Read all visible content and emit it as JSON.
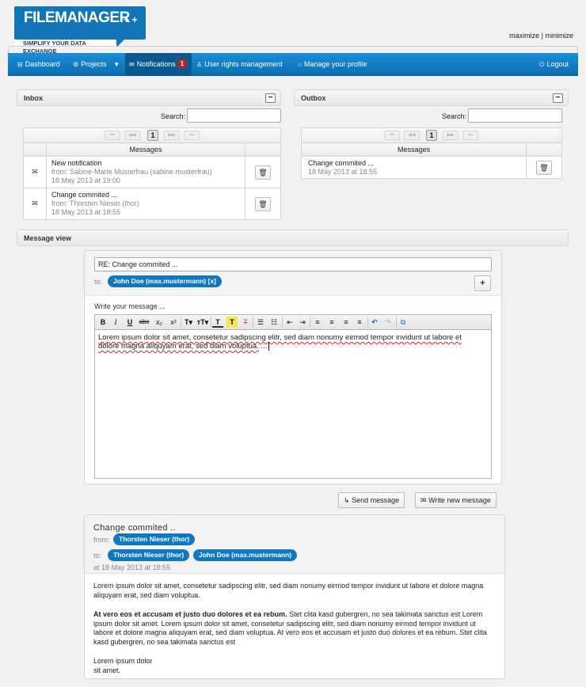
{
  "app": {
    "logo_name": "FILEMANAGER",
    "logo_plus": "+ +",
    "tagline": "SIMPLIFY YOUR DATA EXCHANGE",
    "maximize": "maximize",
    "separator": "|",
    "minimize": "minimize"
  },
  "nav": {
    "dashboard": "Dashboard",
    "projects": "Projects",
    "notifications": "Notifications",
    "notifications_count": "1",
    "user_rights": "User rights management",
    "profile": "Manage your profile",
    "logout": "Logout"
  },
  "icons": {
    "dashboard": "dashboard-icon",
    "projects": "projects-icon",
    "notifications": "envelope-icon",
    "user_rights": "user-icon",
    "profile": "home-icon",
    "logout": "power-icon",
    "trash": "trash-icon",
    "read": "open-envelope-icon",
    "unread": "envelope-icon"
  },
  "inbox": {
    "title": "Inbox",
    "collapse": "−",
    "search_label": "Search:",
    "page": "1",
    "column": "Messages",
    "items": [
      {
        "title": "New notification",
        "from": "from: Sabine-Marie Musterfrau (sabine.musterfrau)",
        "date": "18 May 2013 at 19:00"
      },
      {
        "title": "Change commited ...",
        "from": "from: Thorsten Nieser (thor)",
        "date": "18 May 2013 at 18:55"
      }
    ]
  },
  "outbox": {
    "title": "Outbox",
    "collapse": "−",
    "search_label": "Search:",
    "page": "1",
    "column": "Messages",
    "items": [
      {
        "title": "Change commited ...",
        "date": "18 May 2013 at 18:55"
      }
    ]
  },
  "message_view": {
    "title": "Message view"
  },
  "compose": {
    "subject": "RE: Change commited ...",
    "to_label": "to:",
    "recipient": "John Doe (max.mustermann) [x]",
    "add": "+",
    "write_label": "Write your message ...",
    "body_line1": "Lorem ipsum dolor sit amet, consetetur sadipscing elitr, sed diam nonumy eirmod tempor invidunt ut labore et",
    "body_line2": "dolore magna aliquyam erat, sed diam voluptua.",
    "body_tail": " ...",
    "send": "Send message",
    "write_new": "Write new message"
  },
  "toolbar": {
    "bold": "B",
    "italic": "I",
    "underline": "U",
    "strike": "abc",
    "sub": "x₂",
    "sup": "x²",
    "font_size": "T▾",
    "font_family": "ᴛT▾",
    "text_color": "T",
    "bg_color": "T",
    "clear": "T",
    "ul": "☰",
    "ol": "☷",
    "outdent": "⇤",
    "indent": "⇥",
    "align_left": "≡",
    "align_center": "≡",
    "align_right": "≡",
    "justify": "≡",
    "undo": "↶",
    "redo": "↷",
    "source": "⧉"
  },
  "viewer": {
    "subject": "Change commited ..",
    "from_label": "from:",
    "from_pill": "Thorsten Nieser (thor)",
    "to_label": "to:",
    "to_pill1": "Thorsten Nieser (thor)",
    "to_pill2": "John Doe (max.mustermann)",
    "date": "at 18 May 2013 at 18:55",
    "para1": "Lorem ipsum dolor sit amet, consetetur sadipscing elitr, sed diam nonumy eirmod tempor invidunt ut labore et dolore magna aliquyam erat, sed diam voluptua.",
    "para2_bold": "At vero eos et accusam et justo duo dolores et ea rebum.",
    "para2_rest": " Stet clita kasd gubergren, no sea takimata sanctus est Lorem ipsum dolor sit amet. Lorem ipsum dolor sit amet, consetetur sadipscing elitr, sed diam nonumy eirmod tempor invidunt ut labore et dolore magna aliquyam erat, sed diam voluptua. At vero eos et accusam et justo duo dolores et ea rebum. Stet clita kasd gubergren, no sea takimata sanctus est",
    "sign1": "Lorem ipsum dolor",
    "sign2": "sit amet."
  },
  "colors": {
    "brand": "#1275b5",
    "nav": "#0f7dc4",
    "badge": "#c81d1d",
    "pill": "#1178c0"
  }
}
